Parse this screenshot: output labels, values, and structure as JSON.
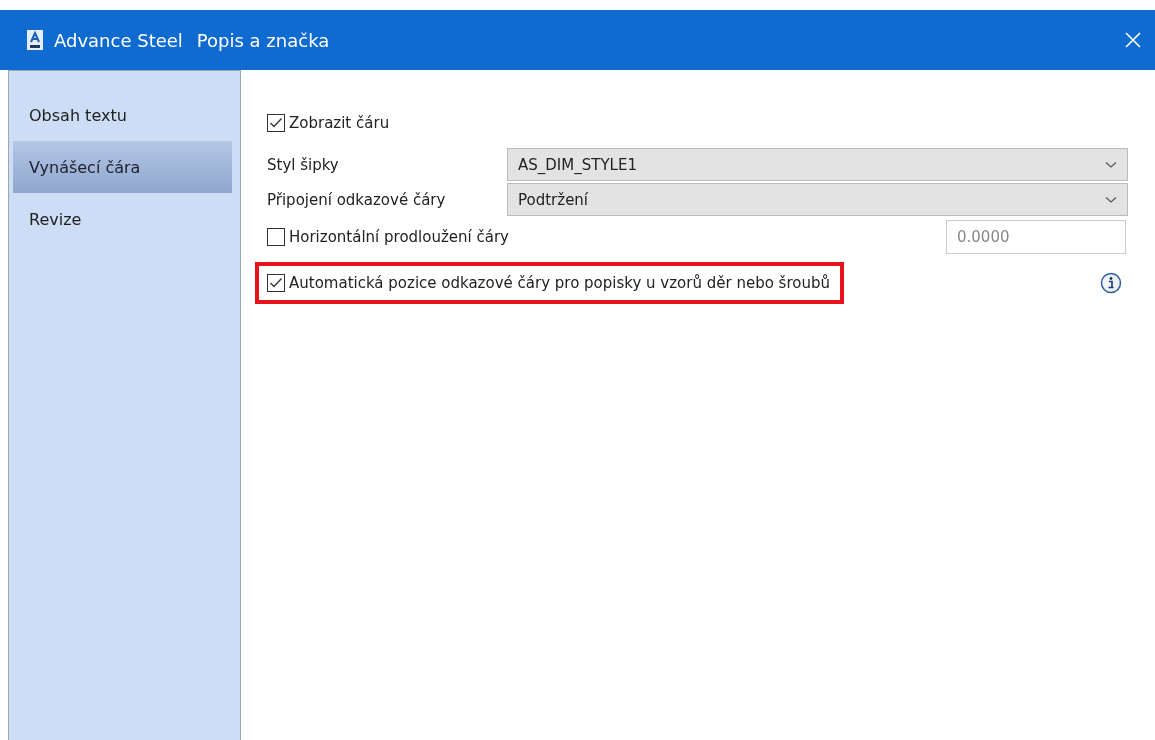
{
  "window": {
    "title_app": "Advance Steel",
    "title": "Popis a značka"
  },
  "sidebar": {
    "items": [
      {
        "label": "Obsah textu",
        "selected": false
      },
      {
        "label": "Vynášecí čára",
        "selected": true
      },
      {
        "label": "Revize",
        "selected": false
      }
    ]
  },
  "rows": [
    {
      "kind": "checkbox",
      "label": "Zobrazit čáru",
      "checked": true,
      "highlighted": false
    },
    {
      "kind": "combo",
      "label": "Styl šipky",
      "value": "AS_DIM_STYLE1"
    },
    {
      "kind": "combo",
      "label": "Připojení odkazové čáry",
      "value": "Podtržení"
    },
    {
      "kind": "checkbox",
      "label": "Horizontální prodloužení čáry",
      "checked": false,
      "highlighted": false,
      "field": {
        "value": "0.0000",
        "disabled": true
      }
    },
    {
      "kind": "checkbox",
      "label": "Automatická pozice odkazové čáry pro popisky u vzorů děr nebo šroubů",
      "checked": true,
      "highlighted": true,
      "info": true
    }
  ]
}
